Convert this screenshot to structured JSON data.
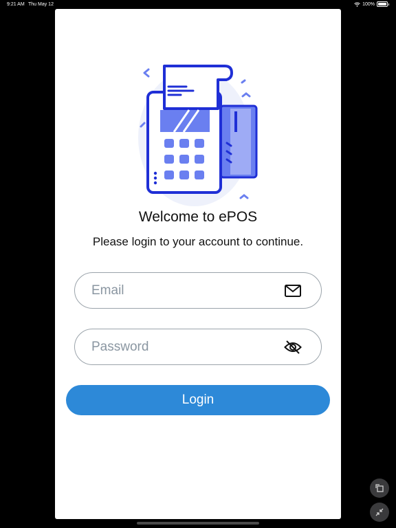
{
  "status_bar": {
    "time": "9:21 AM",
    "date": "Thu May 12",
    "battery": "100%"
  },
  "login": {
    "title": "Welcome to ePOS",
    "subtitle": "Please login to your account to continue.",
    "email": {
      "placeholder": "Email",
      "value": "",
      "icon": "mail-icon"
    },
    "password": {
      "placeholder": "Password",
      "value": "",
      "icon": "eye-off-icon"
    },
    "submit_label": "Login"
  },
  "illustration": {
    "name": "pos-terminal-illustration"
  },
  "colors": {
    "accent": "#2d89d8",
    "illustration_blue": "#1f2fd6",
    "illustration_fill": "#6a7ff0"
  },
  "system_buttons": [
    {
      "name": "rotate-window-icon"
    },
    {
      "name": "minimize-window-icon"
    }
  ]
}
